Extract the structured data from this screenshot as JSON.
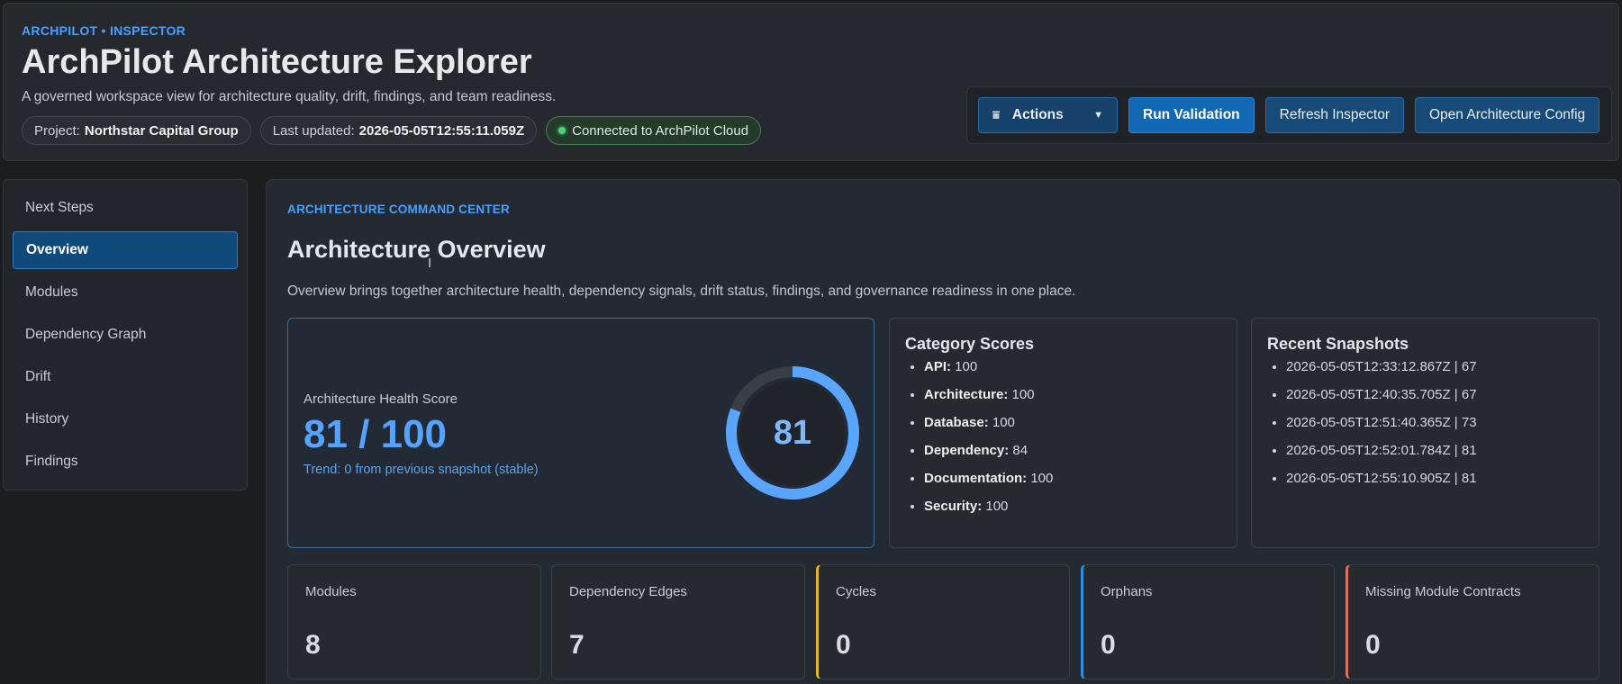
{
  "header": {
    "eyebrow": "ARCHPILOT • INSPECTOR",
    "title": "ArchPilot Architecture Explorer",
    "subtitle": "A governed workspace view for architecture quality, drift, findings, and team readiness.",
    "project_label": "Project:",
    "project_value": "Northstar Capital Group",
    "updated_label": "Last updated:",
    "updated_value": "2026-05-05T12:55:11.059Z",
    "connection_status": "Connected to ArchPilot Cloud"
  },
  "toolbar": {
    "actions_label": "Actions",
    "run_validation_label": "Run Validation",
    "refresh_label": "Refresh Inspector",
    "open_config_label": "Open Architecture Config"
  },
  "sidebar": {
    "items": [
      {
        "label": "Next Steps",
        "active": false
      },
      {
        "label": "Overview",
        "active": true
      },
      {
        "label": "Modules",
        "active": false
      },
      {
        "label": "Dependency Graph",
        "active": false
      },
      {
        "label": "Drift",
        "active": false
      },
      {
        "label": "History",
        "active": false
      },
      {
        "label": "Findings",
        "active": false
      }
    ]
  },
  "main": {
    "eyebrow": "ARCHITECTURE COMMAND CENTER",
    "title": "Architecture Overview",
    "description": "Overview brings together architecture health, dependency signals, drift status, findings, and governance readiness in one place.",
    "health": {
      "label": "Architecture Health Score",
      "score_text": "81 / 100",
      "score": 81,
      "max": 100,
      "ring_value": "81",
      "trend": "Trend: 0 from previous snapshot (stable)"
    },
    "categories": {
      "title": "Category Scores",
      "items": [
        {
          "name": "API:",
          "value": "100"
        },
        {
          "name": "Architecture:",
          "value": "100"
        },
        {
          "name": "Database:",
          "value": "100"
        },
        {
          "name": "Dependency:",
          "value": "84"
        },
        {
          "name": "Documentation:",
          "value": "100"
        },
        {
          "name": "Security:",
          "value": "100"
        }
      ]
    },
    "snapshots": {
      "title": "Recent Snapshots",
      "items": [
        "2026-05-05T12:33:12.867Z | 67",
        "2026-05-05T12:40:35.705Z | 67",
        "2026-05-05T12:51:40.365Z | 73",
        "2026-05-05T12:52:01.784Z | 81",
        "2026-05-05T12:55:10.905Z | 81"
      ]
    },
    "metrics": [
      {
        "label": "Modules",
        "value": "8"
      },
      {
        "label": "Dependency Edges",
        "value": "7"
      },
      {
        "label": "Cycles",
        "value": "0"
      },
      {
        "label": "Orphans",
        "value": "0"
      },
      {
        "label": "Missing Module Contracts",
        "value": "0"
      }
    ]
  },
  "colors": {
    "accent": "#4a9eff",
    "primary_button": "#1268b3",
    "cycles_accent": "#e0b62a",
    "orphans_accent": "#2f8fe6",
    "contracts_accent": "#d9735e",
    "connected": "#4cd37a"
  }
}
